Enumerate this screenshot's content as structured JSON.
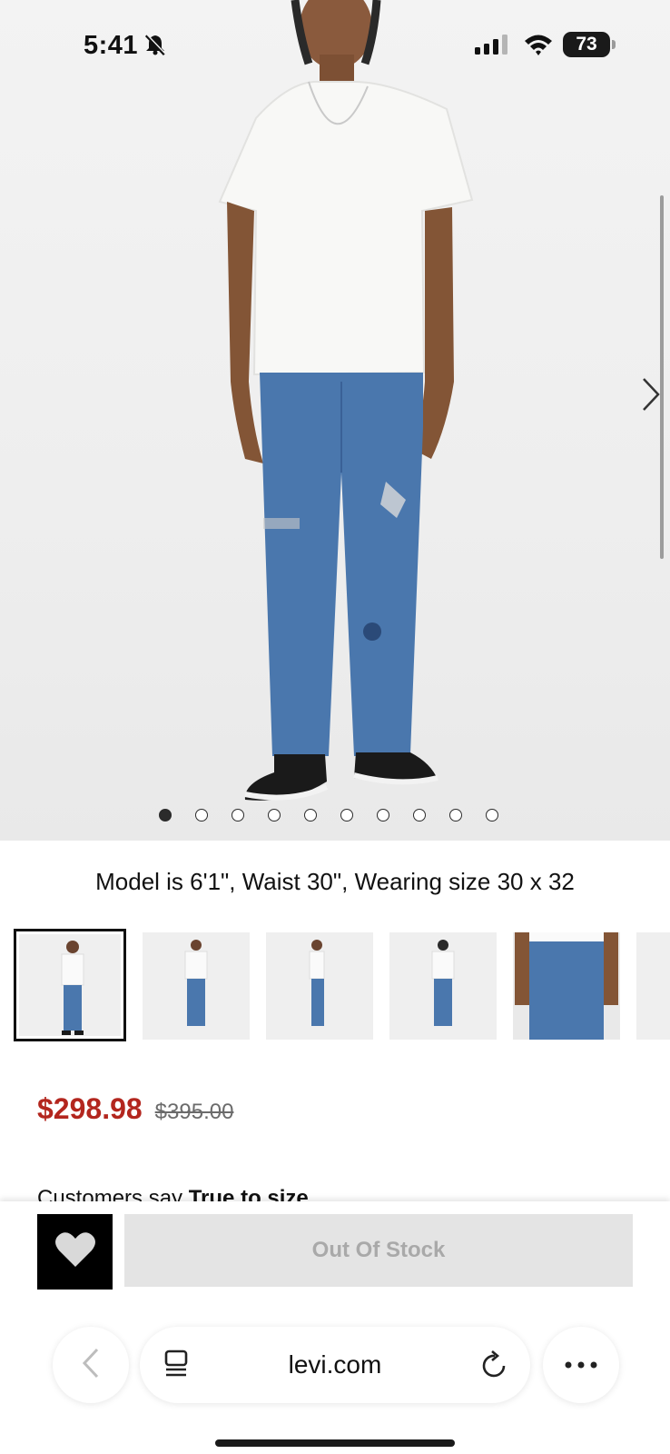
{
  "status_bar": {
    "time": "5:41",
    "battery": "73"
  },
  "hero": {
    "image_description_icon": "model-photo",
    "carousel_total": 10,
    "carousel_active_index": 0
  },
  "product": {
    "model_info": "Model is 6'1\", Waist 30\", Wearing size 30 x 32",
    "price_sale": "$298.98",
    "price_original": "$395.00",
    "customers_prefix": "Customers say",
    "customers_value": "True to size"
  },
  "actions": {
    "stock_label": "Out Of Stock"
  },
  "browser": {
    "url": "levi.com"
  },
  "colors": {
    "sale_price": "#b3261e",
    "button_disabled_bg": "#e4e4e4",
    "button_disabled_text": "#a9a9a9",
    "favorite_bg": "#000000"
  }
}
